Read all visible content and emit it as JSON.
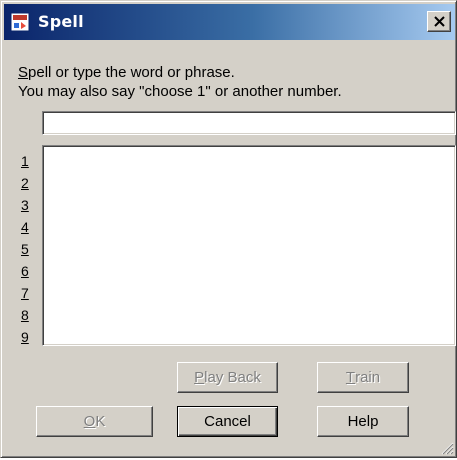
{
  "window": {
    "title": "Spell",
    "app_icon": "speech-app-icon",
    "close_icon": "close-icon"
  },
  "instructions": {
    "line1_mnemonic": "S",
    "line1_rest": "pell or type the word or phrase.",
    "line2": "You may also say \"choose 1\" or another number."
  },
  "spell_input": {
    "value": ""
  },
  "choices": {
    "numbers": [
      "1",
      "2",
      "3",
      "4",
      "5",
      "6",
      "7",
      "8",
      "9"
    ],
    "items": []
  },
  "buttons": {
    "play_back": {
      "mnemonic": "P",
      "rest": "lay Back",
      "enabled": false
    },
    "train": {
      "mnemonic": "T",
      "rest": "rain",
      "enabled": false
    },
    "ok": {
      "mnemonic": "O",
      "rest": "K",
      "enabled": false
    },
    "cancel": {
      "label": "Cancel",
      "enabled": true
    },
    "help": {
      "label": "Help",
      "enabled": true
    }
  },
  "colors": {
    "titlebar_start": "#0a246a",
    "titlebar_end": "#a6caf0",
    "face": "#d4d0c8"
  }
}
